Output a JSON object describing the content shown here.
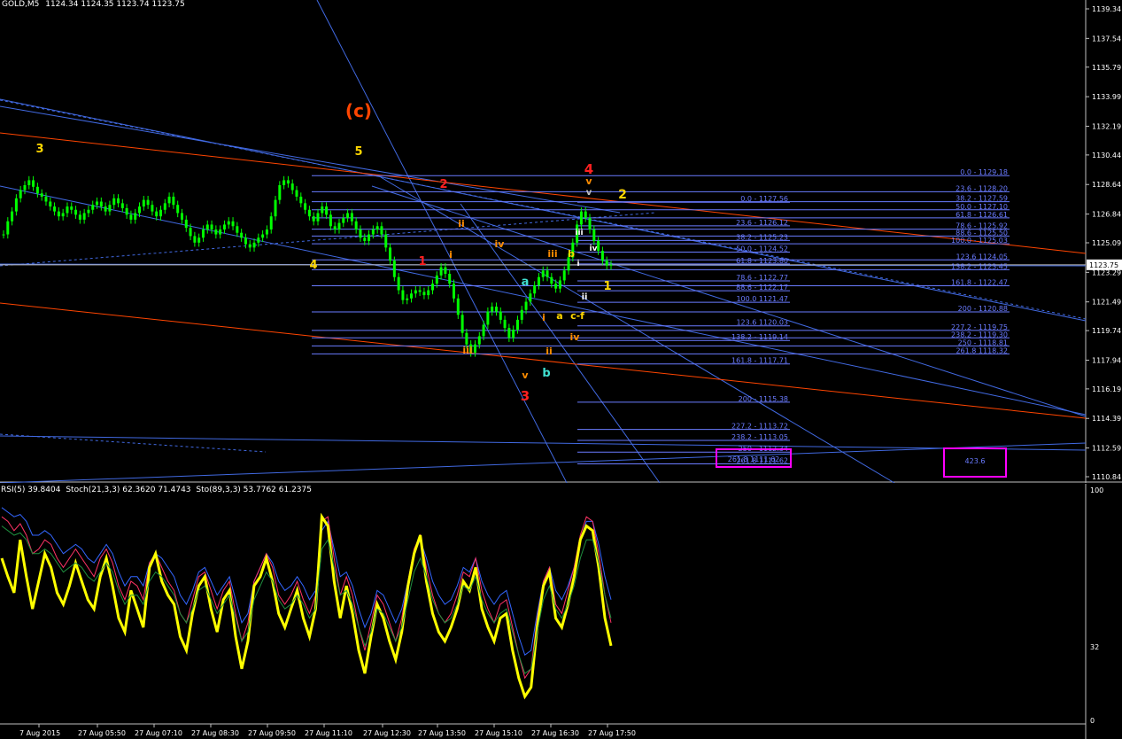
{
  "header": {
    "symbol": "GOLD,M5",
    "quote": "1124.34 1124.35 1123.74 1123.75"
  },
  "indicator_header": {
    "rsi": "RSI(5) 39.8404",
    "stoch1": "Stoch(21,3,3) 62.3620 71.4743",
    "stoch2": "Sto(89,3,3) 53.7762 61.2375"
  },
  "price_axis": {
    "ticks": [
      "1139.34",
      "1137.54",
      "1135.79",
      "1133.99",
      "1132.19",
      "1130.44",
      "1128.64",
      "1126.84",
      "1125.09",
      "1123.29",
      "1121.49",
      "1119.74",
      "1117.94",
      "1116.19",
      "1114.39",
      "1112.59",
      "1110.84"
    ],
    "current_price": "1123.75"
  },
  "indicator_axis": {
    "ticks": [
      "100",
      "32",
      "0"
    ]
  },
  "time_axis": {
    "ticks": [
      "7 Aug 2015",
      "27 Aug 05:50",
      "27 Aug 07:10",
      "27 Aug 08:30",
      "27 Aug 09:50",
      "27 Aug 11:10",
      "27 Aug 12:30",
      "27 Aug 13:50",
      "27 Aug 15:10",
      "27 Aug 16:30",
      "27 Aug 17:50"
    ]
  },
  "fib_levels": [
    {
      "text": "0.0 - 1129.18"
    },
    {
      "text": "23.6 - 1128.20"
    },
    {
      "text": "38.2 - 1127.59"
    },
    {
      "text": "50.0 - 1127.10"
    },
    {
      "text": "61.8 - 1126.61"
    },
    {
      "text": "78.6 - 1125.92"
    },
    {
      "text": "88.6 - 1125.50"
    },
    {
      "text": "100.0 - 1125.03"
    },
    {
      "text": "123.6 1124.05"
    },
    {
      "text": "138.2 - 1123.45"
    },
    {
      "text": "161.8 - 1122.47"
    },
    {
      "text": "200 - 1120.88"
    },
    {
      "text": "227.2 - 1119.75"
    },
    {
      "text": "238.2 - 1119.30"
    },
    {
      "text": "250 - 1118.81"
    },
    {
      "text": "261.8 1118.32"
    },
    {
      "text": "0.0 - 1127.56"
    },
    {
      "text": "23.6 - 1126.12"
    },
    {
      "text": "38.2 - 1125.23"
    },
    {
      "text": "50.0 - 1124.52"
    },
    {
      "text": "61.8 - 1123.80"
    },
    {
      "text": "78.6 - 1122.77"
    },
    {
      "text": "88.6 - 1122.17"
    },
    {
      "text": "100.0 1121.47"
    },
    {
      "text": "123.6 1120.03"
    },
    {
      "text": "138.2 - 1119.14"
    },
    {
      "text": "161.8 - 1117.71"
    },
    {
      "text": "200 - 1115.38"
    },
    {
      "text": "227.2 - 1113.72"
    },
    {
      "text": "238.2 - 1113.05"
    },
    {
      "text": "250 - 1112.34"
    },
    {
      "text": "261.8 1111.62"
    }
  ],
  "box_labels": {
    "left": "261.8 1111.62",
    "right": "423.6"
  },
  "wave_labels": [
    {
      "text": "(c)",
      "color": "#ff4500"
    },
    {
      "text": "3",
      "color": "#ffd700"
    },
    {
      "text": "5",
      "color": "#ffd700"
    },
    {
      "text": "4",
      "color": "#ffd700"
    },
    {
      "text": "2",
      "color": "#ff2020"
    },
    {
      "text": "1",
      "color": "#ff2020"
    },
    {
      "text": "i",
      "color": "#ff8c00"
    },
    {
      "text": "ii",
      "color": "#ff8c00"
    },
    {
      "text": "iii",
      "color": "#ff8c00"
    },
    {
      "text": "iv",
      "color": "#ff8c00"
    },
    {
      "text": "v",
      "color": "#ff8c00"
    },
    {
      "text": "a",
      "color": "#40e0d0"
    },
    {
      "text": "b",
      "color": "#40e0d0"
    },
    {
      "text": "3",
      "color": "#ff2020"
    },
    {
      "text": "i",
      "color": "#ff8c00"
    },
    {
      "text": "ii",
      "color": "#ff8c00"
    },
    {
      "text": "iii",
      "color": "#ff8c00"
    },
    {
      "text": "iv",
      "color": "#ff8c00"
    },
    {
      "text": "a",
      "color": "#ffd700"
    },
    {
      "text": "b",
      "color": "#ffd700"
    },
    {
      "text": "c-f",
      "color": "#ffd700"
    },
    {
      "text": "4",
      "color": "#ff2020"
    },
    {
      "text": "v",
      "color": "#ff8c00"
    },
    {
      "text": "v",
      "color": "#c0c0c0"
    },
    {
      "text": "2",
      "color": "#ffd700"
    },
    {
      "text": "1",
      "color": "#ffd700"
    },
    {
      "text": "iii",
      "color": "#ffffff"
    },
    {
      "text": "iv",
      "color": "#ffffff"
    },
    {
      "text": "ii",
      "color": "#ffffff"
    },
    {
      "text": "i",
      "color": "#ffffff"
    }
  ],
  "colors": {
    "background": "#000000",
    "bullish_candle": "#00ff00",
    "bearish_candle": "#00ff00",
    "trend_blue": "#4169e1",
    "trend_red": "#ff4500",
    "fib": "#6a7bff",
    "box": "#ff00ff",
    "rsi": "#ffff00",
    "grid_text": "#ffffff"
  },
  "chart_data": [
    {
      "type": "candlestick",
      "title": "GOLD,M5",
      "ylim": [
        1110.84,
        1139.34
      ],
      "series": [
        {
          "close": [
            1125.6,
            1126.4,
            1127.0,
            1127.8,
            1128.3,
            1128.6,
            1128.9,
            1128.5,
            1128.1,
            1127.9,
            1127.6,
            1127.3,
            1127.0,
            1126.7,
            1126.9,
            1127.3,
            1127.1,
            1126.8,
            1126.5,
            1126.9,
            1127.1,
            1127.4,
            1127.6,
            1127.3,
            1127.0,
            1127.4,
            1127.8,
            1127.5,
            1127.2,
            1126.8,
            1126.5,
            1126.9,
            1127.3,
            1127.7,
            1127.4,
            1127.0,
            1126.7,
            1127.1,
            1127.5,
            1127.9,
            1127.4,
            1126.9,
            1126.5,
            1126.0,
            1125.5,
            1125.1,
            1125.4,
            1125.9,
            1126.2,
            1125.9,
            1125.6,
            1125.9,
            1126.2,
            1126.4,
            1126.1,
            1125.7,
            1125.4,
            1125.0,
            1124.8,
            1125.1,
            1125.4,
            1125.6,
            1125.9,
            1126.7,
            1127.7,
            1128.6,
            1128.9,
            1128.7,
            1128.3,
            1127.9,
            1127.5,
            1127.1,
            1126.7,
            1126.4,
            1126.9,
            1127.3,
            1126.8,
            1126.1,
            1125.9,
            1126.3,
            1126.6,
            1126.9,
            1126.4,
            1125.9,
            1125.4,
            1125.2,
            1125.6,
            1125.9,
            1126.1,
            1125.6,
            1124.8,
            1124.0,
            1123.0,
            1122.2,
            1121.6,
            1121.7,
            1122.0,
            1122.2,
            1122.1,
            1121.9,
            1122.2,
            1122.6,
            1123.1,
            1123.6,
            1123.2,
            1122.6,
            1121.7,
            1120.7,
            1119.6,
            1118.9,
            1118.4,
            1118.9,
            1119.4,
            1120.1,
            1120.9,
            1121.2,
            1120.9,
            1120.4,
            1119.9,
            1119.3,
            1119.8,
            1120.4,
            1121.0,
            1121.5,
            1122.0,
            1122.5,
            1123.0,
            1123.4,
            1123.0,
            1122.6,
            1122.3,
            1122.8,
            1123.4,
            1124.2,
            1125.1,
            1126.2,
            1127.0,
            1126.6,
            1125.9,
            1125.2,
            1124.6,
            1124.0,
            1123.7,
            1123.75
          ]
        }
      ]
    },
    {
      "type": "line",
      "title": "RSI(5) 39.8404",
      "ylim": [
        0,
        100
      ],
      "series": [
        {
          "name": "RSI(5)",
          "values": [
            70,
            62,
            55,
            78,
            62,
            48,
            60,
            72,
            66,
            55,
            50,
            58,
            68,
            60,
            52,
            48,
            62,
            70,
            58,
            44,
            38,
            56,
            48,
            40,
            66,
            72,
            60,
            54,
            50,
            36,
            30,
            46,
            58,
            62,
            48,
            38,
            52,
            56,
            36,
            22,
            34,
            58,
            62,
            70,
            60,
            46,
            40,
            48,
            56,
            44,
            36,
            48,
            88,
            84,
            60,
            44,
            58,
            46,
            30,
            20,
            36,
            50,
            44,
            34,
            26,
            38,
            58,
            72,
            80,
            60,
            46,
            38,
            34,
            40,
            48,
            60,
            56,
            66,
            48,
            40,
            34,
            44,
            46,
            30,
            18,
            10,
            14,
            40,
            58,
            64,
            44,
            40,
            50,
            62,
            78,
            84,
            82,
            66,
            44,
            32
          ]
        },
        {
          "name": "Stoch(21,3,3)",
          "values": [
            88,
            86,
            82,
            85,
            80,
            72,
            74,
            78,
            76,
            70,
            66,
            70,
            74,
            70,
            66,
            62,
            70,
            74,
            68,
            58,
            52,
            60,
            58,
            52,
            68,
            72,
            66,
            60,
            56,
            46,
            42,
            52,
            62,
            64,
            56,
            48,
            56,
            60,
            46,
            34,
            42,
            60,
            66,
            72,
            66,
            54,
            50,
            54,
            60,
            52,
            46,
            54,
            86,
            88,
            70,
            54,
            62,
            54,
            40,
            30,
            42,
            54,
            50,
            42,
            34,
            44,
            60,
            74,
            80,
            66,
            54,
            46,
            42,
            46,
            54,
            64,
            62,
            70,
            56,
            48,
            42,
            50,
            52,
            40,
            28,
            18,
            22,
            44,
            60,
            66,
            50,
            46,
            56,
            66,
            80,
            88,
            86,
            72,
            54,
            42
          ]
        },
        {
          "name": "Sto(89,3,3)",
          "values": [
            92,
            90,
            88,
            89,
            86,
            80,
            80,
            82,
            80,
            76,
            72,
            74,
            76,
            74,
            70,
            68,
            72,
            76,
            72,
            64,
            58,
            62,
            62,
            58,
            68,
            72,
            70,
            66,
            62,
            54,
            50,
            56,
            64,
            66,
            60,
            54,
            58,
            62,
            52,
            42,
            46,
            60,
            66,
            72,
            68,
            60,
            56,
            58,
            62,
            58,
            52,
            56,
            82,
            86,
            74,
            62,
            64,
            58,
            48,
            40,
            46,
            56,
            54,
            48,
            42,
            48,
            60,
            72,
            78,
            70,
            60,
            54,
            50,
            52,
            58,
            66,
            64,
            70,
            60,
            54,
            50,
            54,
            56,
            46,
            36,
            28,
            30,
            46,
            60,
            66,
            56,
            52,
            58,
            66,
            78,
            86,
            86,
            76,
            62,
            52
          ]
        }
      ]
    }
  ]
}
